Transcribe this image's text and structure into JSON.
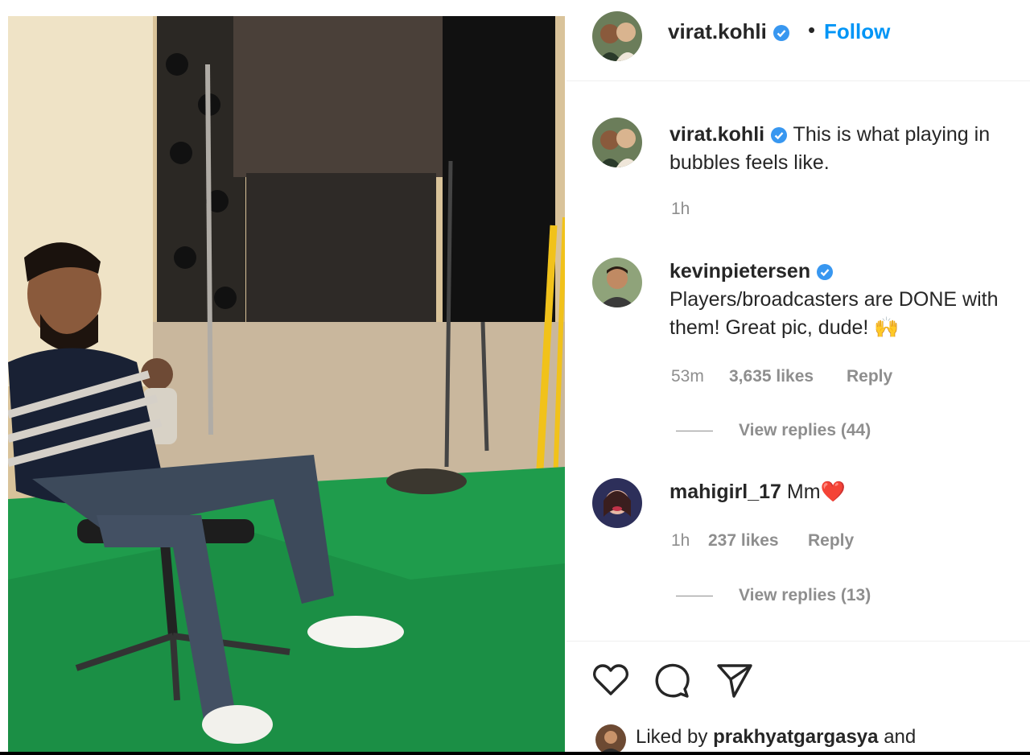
{
  "post": {
    "author": "virat.kohli",
    "follow_label": "Follow",
    "separator": "•",
    "photo_description_icon": "photo"
  },
  "caption": {
    "username": "virat.kohli",
    "text": "This is what playing in bubbles feels like.",
    "time": "1h"
  },
  "comments": [
    {
      "username": "kevinpietersen",
      "verified": true,
      "text": "Players/broadcasters are DONE with them! Great pic, dude! 🙌",
      "time": "53m",
      "likes": "3,635 likes",
      "reply_label": "Reply",
      "view_replies": "View replies (44)"
    },
    {
      "username": "mahigirl_17",
      "verified": false,
      "text": "Mm❤️",
      "time": "1h",
      "likes": "237 likes",
      "reply_label": "Reply",
      "view_replies": "View replies (13)"
    }
  ],
  "actions": {
    "like_icon": "heart-icon",
    "comment_icon": "comment-icon",
    "share_icon": "share-icon"
  },
  "liked_by": {
    "prefix": "Liked by",
    "user": "prakhyatgargasya",
    "suffix": "and"
  },
  "colors": {
    "link": "#0095f6",
    "verified": "#3897f0",
    "muted": "#8e8e8e",
    "green_screen": "#1e9f4e"
  }
}
